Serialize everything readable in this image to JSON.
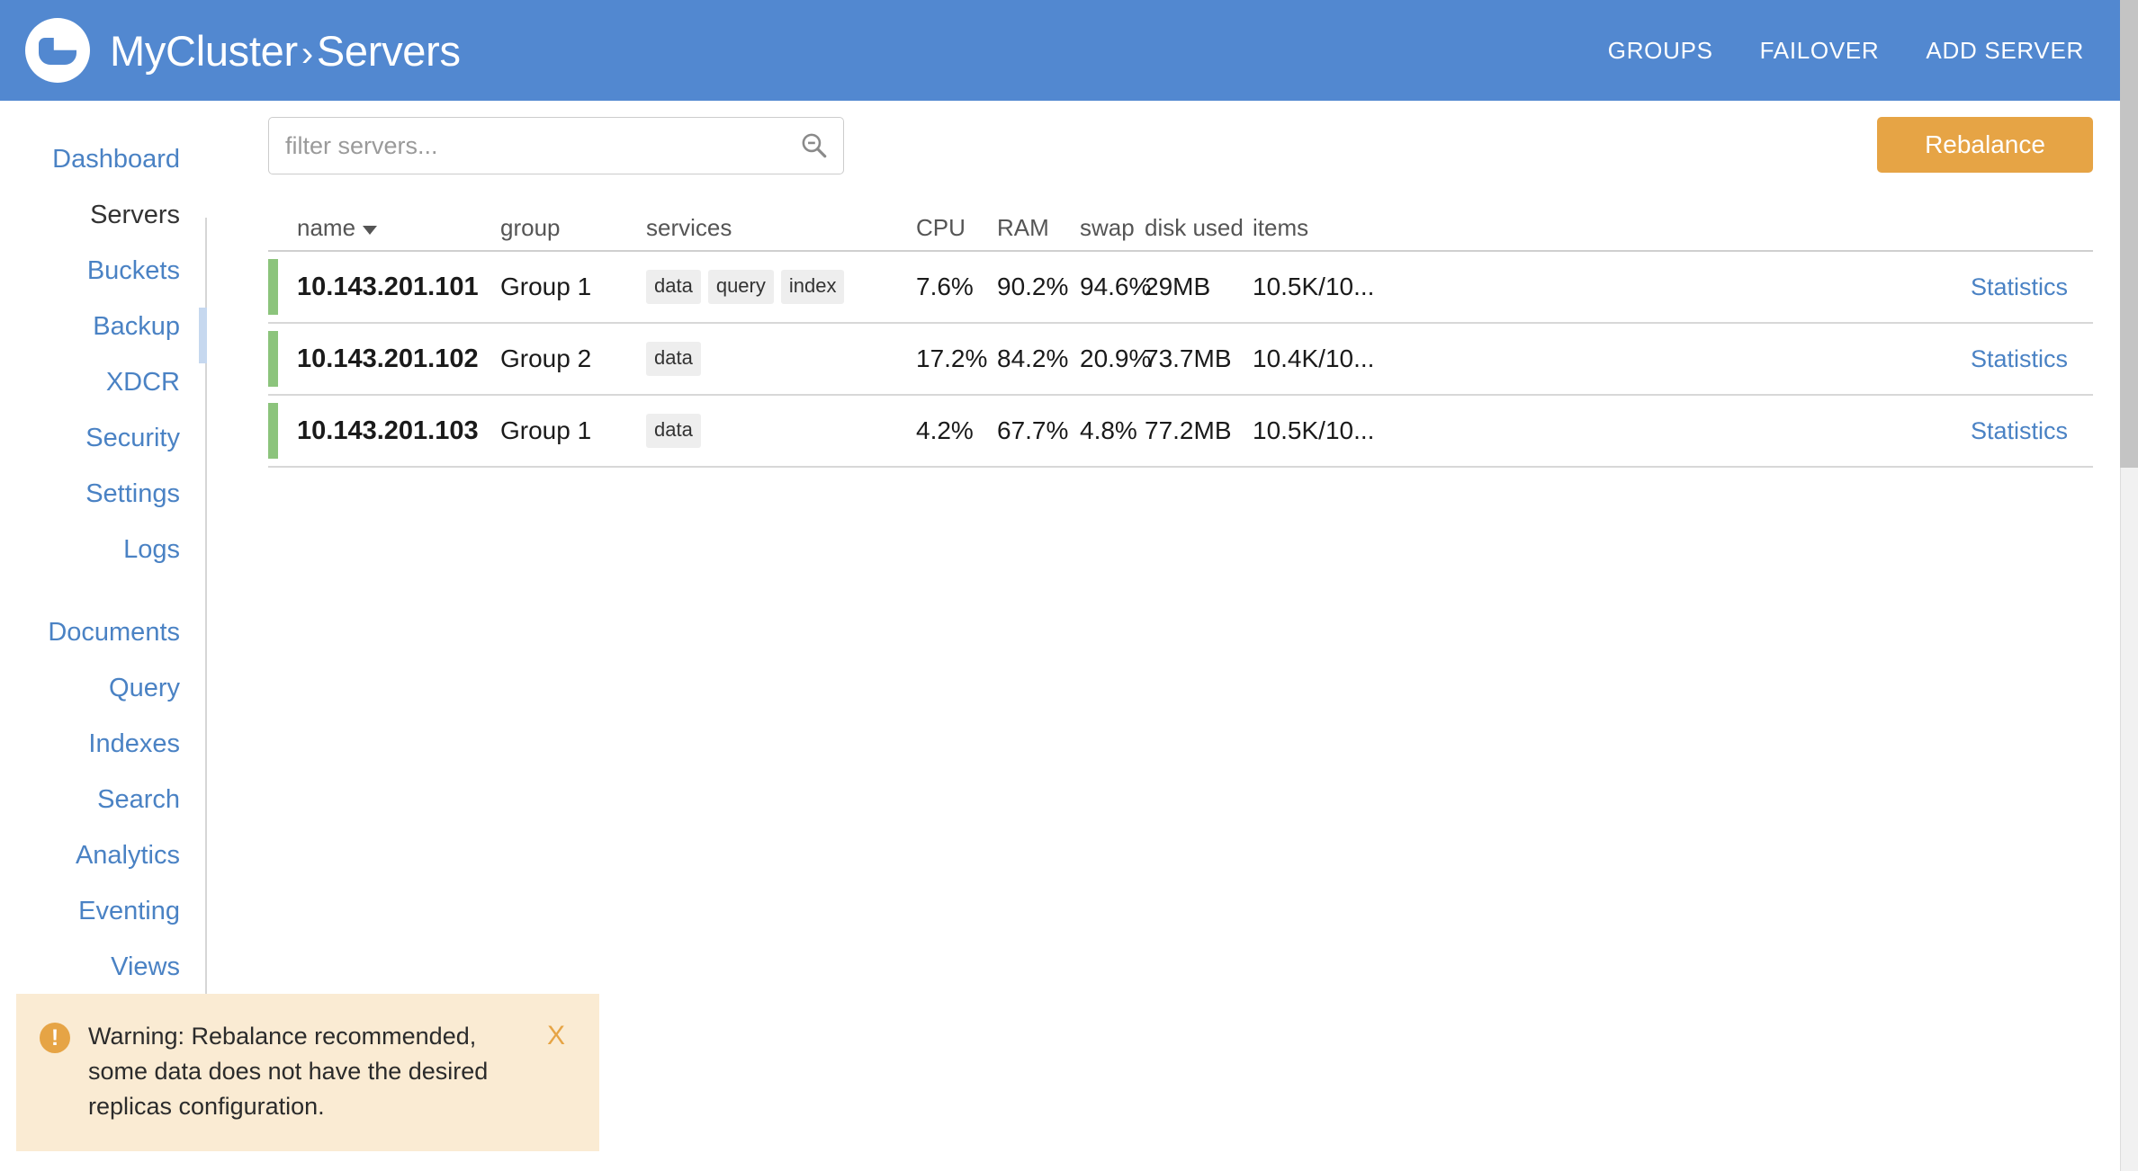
{
  "header": {
    "logo_icon": "couchbase-logo-icon",
    "cluster_name": "MyCluster",
    "separator": "›",
    "section": "Servers",
    "nav": [
      {
        "label": "GROUPS",
        "name": "groups"
      },
      {
        "label": "FAILOVER",
        "name": "failover"
      },
      {
        "label": "ADD SERVER",
        "name": "add-server"
      }
    ]
  },
  "sidebar": {
    "items": [
      {
        "label": "Dashboard",
        "active": false
      },
      {
        "label": "Servers",
        "active": true
      },
      {
        "label": "Buckets",
        "active": false
      },
      {
        "label": "Backup",
        "active": false
      },
      {
        "label": "XDCR",
        "active": false
      },
      {
        "label": "Security",
        "active": false
      },
      {
        "label": "Settings",
        "active": false
      },
      {
        "label": "Logs",
        "active": false
      }
    ],
    "items2": [
      {
        "label": "Documents",
        "active": false
      },
      {
        "label": "Query",
        "active": false
      },
      {
        "label": "Indexes",
        "active": false
      },
      {
        "label": "Search",
        "active": false
      },
      {
        "label": "Analytics",
        "active": false
      },
      {
        "label": "Eventing",
        "active": false
      },
      {
        "label": "Views",
        "active": false
      }
    ]
  },
  "toolbar": {
    "filter_value": "",
    "filter_placeholder": "filter servers...",
    "search_icon": "search-zoom-out-icon",
    "rebalance_label": "Rebalance"
  },
  "table": {
    "columns": {
      "name": "name",
      "group": "group",
      "services": "services",
      "cpu": "CPU",
      "ram": "RAM",
      "swap": "swap",
      "disk": "disk used",
      "items": "items"
    },
    "sort_caret": "▼",
    "rows": [
      {
        "status": "healthy",
        "name": "10.143.201.101",
        "group": "Group 1",
        "services": [
          "data",
          "query",
          "index"
        ],
        "cpu": "7.6%",
        "ram": "90.2%",
        "swap": "94.6%",
        "disk": "29MB",
        "items": "10.5K/10...",
        "stats_label": "Statistics"
      },
      {
        "status": "healthy",
        "name": "10.143.201.102",
        "group": "Group 2",
        "services": [
          "data"
        ],
        "cpu": "17.2%",
        "ram": "84.2%",
        "swap": "20.9%",
        "disk": "73.7MB",
        "items": "10.4K/10...",
        "stats_label": "Statistics"
      },
      {
        "status": "healthy",
        "name": "10.143.201.103",
        "group": "Group 1",
        "services": [
          "data"
        ],
        "cpu": "4.2%",
        "ram": "67.7%",
        "swap": "4.8%",
        "disk": "77.2MB",
        "items": "10.5K/10...",
        "stats_label": "Statistics"
      }
    ]
  },
  "toast": {
    "icon": "warning-exclamation-icon",
    "icon_glyph": "!",
    "message": "Warning: Rebalance recommended, some data does not have the desired replicas configuration.",
    "close_label": "X"
  },
  "colors": {
    "header_blue": "#5288d0",
    "link_blue": "#4a82c4",
    "accent_orange": "#e6a445",
    "status_green": "#8cc47c",
    "toast_bg": "#faebd3",
    "chip_bg": "#eeeeee"
  }
}
